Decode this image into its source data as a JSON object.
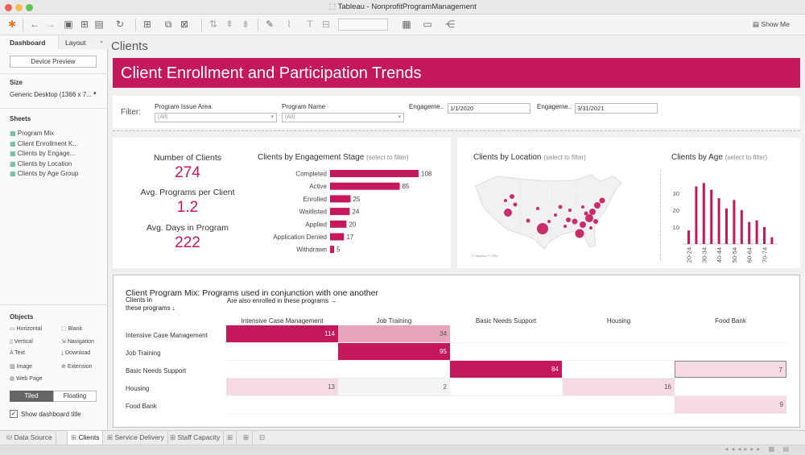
{
  "window": {
    "title": "Tableau - NonprofitProgramManagement"
  },
  "toolbar": {
    "show_me": "Show Me"
  },
  "left_panel": {
    "tabs": {
      "dashboard": "Dashboard",
      "layout": "Layout"
    },
    "device_preview": "Device Preview",
    "size_title": "Size",
    "size_value": "Generic Desktop (1366 x 7...",
    "sheets_title": "Sheets",
    "sheets": [
      "Program Mix",
      "Client Enrollment K...",
      "Clients by Engage...",
      "Clients by Location",
      "Clients by Age Group"
    ],
    "objects_title": "Objects",
    "objects": [
      "Horizontal",
      "Blank",
      "Vertical",
      "Navigation",
      "Text",
      "Download",
      "Image",
      "Extension",
      "Web Page"
    ],
    "tiled": "Tiled",
    "floating": "Floating",
    "show_title": "Show dashboard title"
  },
  "dashboard": {
    "name": "Clients",
    "banner": "Client Enrollment and Participation Trends",
    "filter_label": "Filter:",
    "filters": {
      "issue_label": "Program Issue Area",
      "issue_value": "(All)",
      "name_label": "Program Name",
      "name_value": "(All)",
      "eng1_label": "Engageme..",
      "eng1_value": "1/1/2020",
      "eng2_label": "Engageme..",
      "eng2_value": "3/31/2021"
    },
    "kpis": {
      "clients_label": "Number of Clients",
      "clients_value": "274",
      "avg_prog_label": "Avg. Programs per Client",
      "avg_prog_value": "1.2",
      "avg_days_label": "Avg. Days in Program",
      "avg_days_value": "222"
    },
    "engagement": {
      "title": "Clients by Engagement Stage",
      "hint": "(select to filter)"
    },
    "location": {
      "title": "Clients by Location",
      "hint": "(select to filter)",
      "credit": "© Mapbox © OSM"
    },
    "age": {
      "title": "Clients by Age",
      "hint": "(select to filter)"
    },
    "mix": {
      "title": "Client Program Mix: Programs used in conjunction with one another",
      "row_header_1": "Clients in",
      "row_header_2": "these programs ↓",
      "col_header": "Are also enrolled in these programs →",
      "columns": [
        "Intensive Case Management",
        "Job Training",
        "Basic Needs Support",
        "Housing",
        "Food Bank"
      ],
      "rows": [
        "Intensive Case Management",
        "Job Training",
        "Basic Needs Support",
        "Housing",
        "Food Bank"
      ],
      "cells": [
        {
          "r": 0,
          "c": 0,
          "v": "114",
          "level": "dark"
        },
        {
          "r": 0,
          "c": 1,
          "v": "34",
          "level": "light"
        },
        {
          "r": 1,
          "c": 1,
          "v": "95",
          "level": "dark"
        },
        {
          "r": 2,
          "c": 2,
          "v": "84",
          "level": "dark"
        },
        {
          "r": 2,
          "c": 4,
          "v": "7",
          "level": "pale"
        },
        {
          "r": 3,
          "c": 0,
          "v": "13",
          "level": "pale"
        },
        {
          "r": 3,
          "c": 1,
          "v": "2",
          "level": "none"
        },
        {
          "r": 3,
          "c": 3,
          "v": "16",
          "level": "pale"
        },
        {
          "r": 4,
          "c": 4,
          "v": "9",
          "level": "pale"
        }
      ]
    }
  },
  "bottom_tabs": {
    "data_source": "Data Source",
    "clients": "Clients",
    "service": "Service Delivery",
    "staff": "Staff Capacity"
  },
  "colors": {
    "accent": "#c4175c",
    "accent_light": "#e6a4bd",
    "accent_pale": "#f5d9e3"
  },
  "chart_data": [
    {
      "type": "bar",
      "title": "Clients by Engagement Stage",
      "categories": [
        "Completed",
        "Active",
        "Enrolled",
        "Waitlisted",
        "Applied",
        "Application Denied",
        "Withdrawn"
      ],
      "values": [
        108,
        85,
        25,
        24,
        20,
        17,
        5
      ]
    },
    {
      "type": "bar",
      "title": "Clients by Age",
      "categories": [
        "20-24",
        "25-29",
        "30-34",
        "35-39",
        "40-44",
        "45-49",
        "50-54",
        "55-59",
        "60-64",
        "65-69",
        "70-74",
        "75-79"
      ],
      "values": [
        8,
        34,
        36,
        32,
        27,
        21,
        26,
        20,
        13,
        14,
        10,
        4
      ],
      "x_tick_labels": [
        "20-24",
        "30-34",
        "40-44",
        "50-54",
        "60-64",
        "70-74"
      ],
      "y_ticks": [
        10,
        20,
        30
      ],
      "ylim": [
        0,
        38
      ]
    },
    {
      "type": "scatter",
      "title": "Clients by Location",
      "note": "bubble map of USA, bubble size = clients"
    }
  ]
}
